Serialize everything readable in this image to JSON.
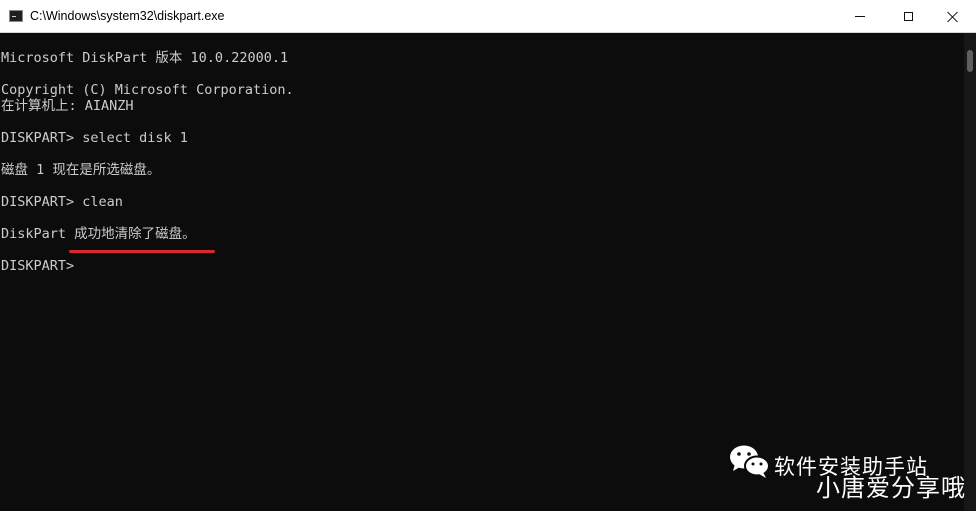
{
  "window": {
    "title": "C:\\Windows\\system32\\diskpart.exe",
    "icon": "console-icon"
  },
  "console": {
    "lines": [
      "Microsoft DiskPart 版本 10.0.22000.1",
      "Copyright (C) Microsoft Corporation.",
      "在计算机上: AIANZH",
      "DISKPART> select disk 1",
      "磁盘 1 现在是所选磁盘。",
      "DISKPART> clean",
      "DiskPart 成功地清除了磁盘。",
      "DISKPART>"
    ]
  },
  "annotation": {
    "color": "#d8282c"
  },
  "watermark": {
    "icon": "wechat-icon",
    "line1": "软件安装助手站",
    "line2": "小唐爱分享哦"
  },
  "colors": {
    "console_bg": "#0c0c0c",
    "console_text": "#cccccc",
    "titlebar_bg": "#ffffff"
  }
}
